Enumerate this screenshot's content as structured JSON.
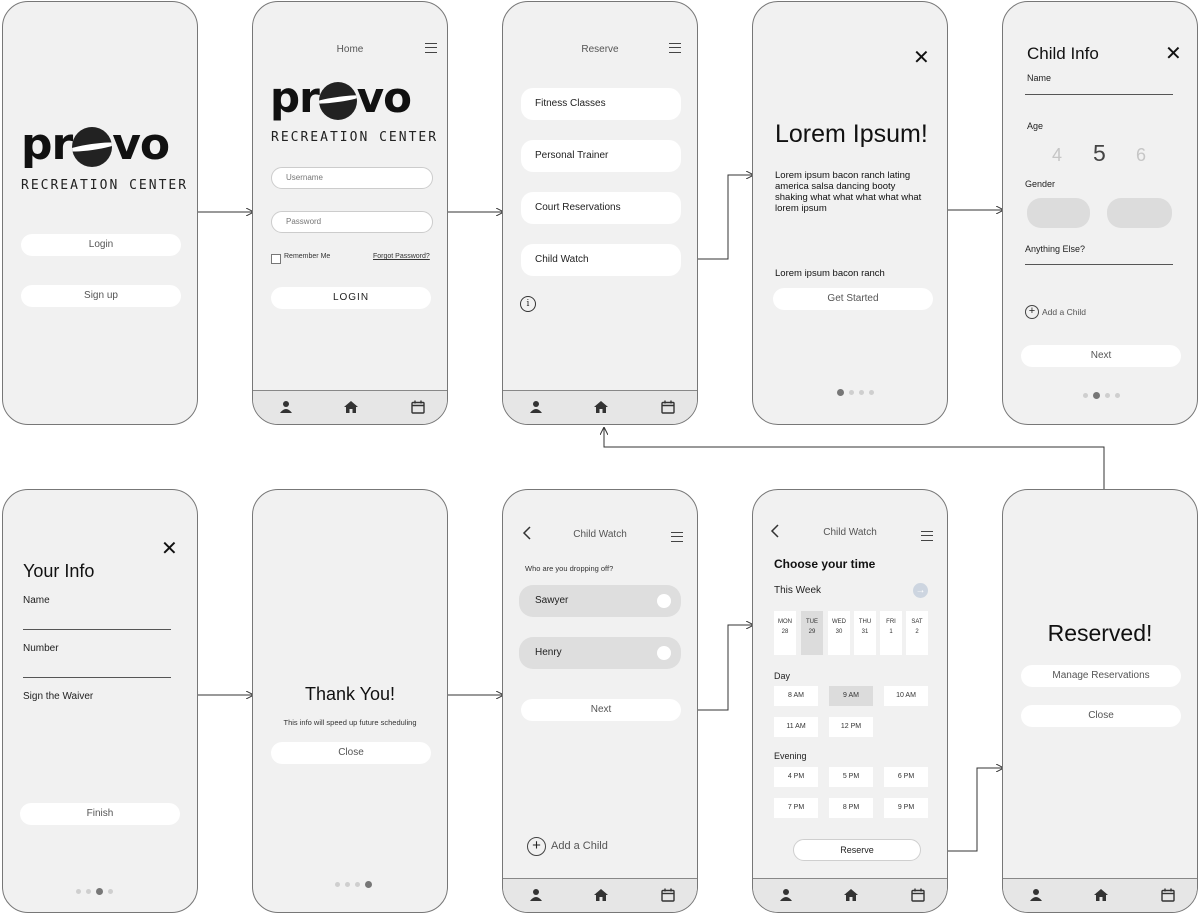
{
  "colors": {
    "screen_bg": "#f1f1f1",
    "pill_bg": "#ffffff",
    "border": "#777777",
    "selected": "#dcdcdc"
  },
  "logo": {
    "word": "prvo",
    "subtitle": "RECREATION CENTER"
  },
  "s1": {
    "login": "Login",
    "signup": "Sign up"
  },
  "s2": {
    "title": "Home",
    "username_ph": "Username",
    "password_ph": "Password",
    "remember": "Remember Me",
    "forgot": "Forgot Password?",
    "login_btn": "LOGIN"
  },
  "s3": {
    "title": "Reserve",
    "items": [
      "Fitness Classes",
      "Personal Trainer",
      "Court Reservations",
      "Child Watch"
    ],
    "info_icon": "info-icon"
  },
  "s4": {
    "heading": "Lorem Ipsum!",
    "body": "Lorem ipsum bacon ranch lating america salsa dancing booty shaking what what what what what lorem ipsum",
    "sub": "Lorem ipsum bacon ranch",
    "cta": "Get Started"
  },
  "s5": {
    "title": "Child Info",
    "name": "Name",
    "age": "Age",
    "ages": [
      "4",
      "5",
      "6"
    ],
    "gender": "Gender",
    "else": "Anything Else?",
    "add": "Add a Child",
    "next": "Next"
  },
  "s6": {
    "title": "Your Info",
    "name": "Name",
    "number": "Number",
    "waiver": "Sign the Waiver",
    "finish": "Finish"
  },
  "s7": {
    "title": "Thank You!",
    "sub": "This info will speed up future scheduling",
    "close": "Close"
  },
  "s8": {
    "title": "Child Watch",
    "question": "Who are you dropping off?",
    "kids": [
      "Sawyer",
      "Henry"
    ],
    "next": "Next",
    "add": "Add a Child"
  },
  "s9": {
    "title": "Child Watch",
    "heading": "Choose your time",
    "week": "This Week",
    "days": [
      {
        "d": "MON",
        "n": "28"
      },
      {
        "d": "TUE",
        "n": "29"
      },
      {
        "d": "WED",
        "n": "30"
      },
      {
        "d": "THU",
        "n": "31"
      },
      {
        "d": "FRI",
        "n": "1"
      },
      {
        "d": "SAT",
        "n": "2"
      }
    ],
    "day_label": "Day",
    "day_times": [
      "8 AM",
      "9 AM",
      "10 AM",
      "11 AM",
      "12 PM"
    ],
    "evening_label": "Evening",
    "evening_times": [
      "4 PM",
      "5 PM",
      "6 PM",
      "7 PM",
      "8 PM",
      "9 PM"
    ],
    "reserve": "Reserve"
  },
  "s10": {
    "title": "Reserved!",
    "manage": "Manage Reservations",
    "close": "Close"
  }
}
